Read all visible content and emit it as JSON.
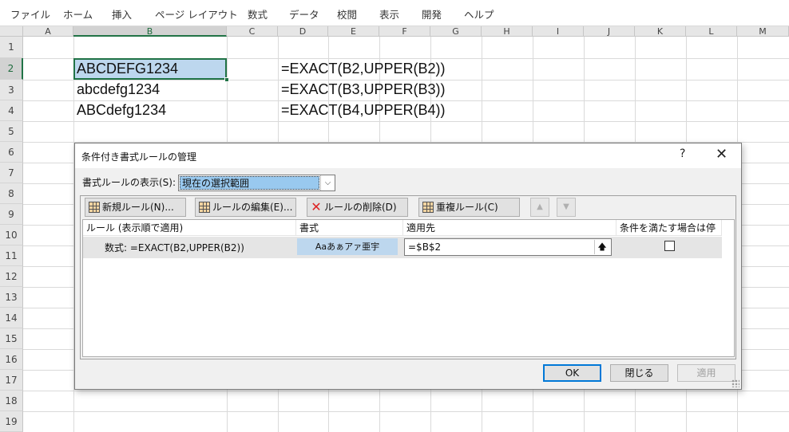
{
  "ribbon": {
    "tabs": [
      "ファイル",
      "ホーム",
      "挿入",
      "ページ レイアウト",
      "数式",
      "データ",
      "校閲",
      "表示",
      "開発",
      "ヘルプ"
    ]
  },
  "sheet": {
    "columns": [
      "A",
      "B",
      "C",
      "D",
      "E",
      "F",
      "G",
      "H",
      "I",
      "J",
      "K",
      "L",
      "M"
    ],
    "rows": [
      "1",
      "2",
      "3",
      "4",
      "5",
      "6",
      "7",
      "8",
      "9",
      "10",
      "11",
      "12",
      "13",
      "14",
      "15",
      "16",
      "17",
      "18",
      "19"
    ],
    "selected_column": "B",
    "selected_row": "2",
    "cells": {
      "B2": "ABCDEFG1234",
      "B3": "abcdefg1234",
      "B4": "ABCdefg1234",
      "D2": "=EXACT(B2,UPPER(B2))",
      "D3": "=EXACT(B3,UPPER(B3))",
      "D4": "=EXACT(B4,UPPER(B4))"
    }
  },
  "dialog": {
    "title": "条件付き書式ルールの管理",
    "help": "?",
    "close": "✕",
    "show_rules_label": "書式ルールの表示(S):",
    "show_rules_value": "現在の選択範囲",
    "toolbar": {
      "new_rule": "新規ルール(N)...",
      "edit_rule": "ルールの編集(E)...",
      "delete_rule": "ルールの削除(D)",
      "duplicate_rule": "重複ルール(C)",
      "move_up": "▲",
      "move_down": "▼"
    },
    "columns": {
      "rule": "ルール (表示順で適用)",
      "format": "書式",
      "applies_to": "適用先",
      "stop_if_true": "条件を満たす場合は停止"
    },
    "rules": [
      {
        "rule": "数式: =EXACT(B2,UPPER(B2))",
        "format_preview": "Aaあぁアァ亜宇",
        "applies_to": "=$B$2",
        "stop_if_true": false
      }
    ],
    "buttons": {
      "ok": "OK",
      "close": "閉じる",
      "apply": "適用"
    }
  },
  "colors": {
    "accent": "#217346",
    "selection_fill": "#bdd7ee",
    "ok_border": "#0078d7"
  }
}
